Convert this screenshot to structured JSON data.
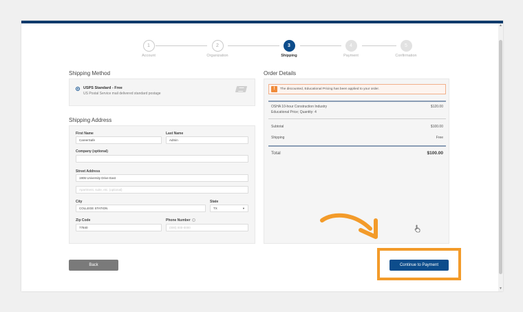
{
  "stepper": {
    "steps": [
      {
        "number": "1",
        "label": "Account"
      },
      {
        "number": "2",
        "label": "Organization"
      },
      {
        "number": "3",
        "label": "Shipping"
      },
      {
        "number": "4",
        "label": "Payment"
      },
      {
        "number": "5",
        "label": "Confirmation"
      }
    ],
    "active_step": 3
  },
  "shipping_method": {
    "title": "Shipping Method",
    "option_name": "USPS Standard - Free",
    "option_desc": "US Postal Service mail delivered standard postage",
    "icon": "usps-eagle-icon"
  },
  "shipping_address": {
    "title": "Shipping Address",
    "first_name_label": "First Name",
    "first_name_value": "CareerSafe",
    "last_name_label": "Last Name",
    "last_name_value": "Admin",
    "company_label": "Company (optional)",
    "company_value": "",
    "street_label": "Street Address",
    "street_value": "1906 University Drive East",
    "street2_placeholder": "Apartment, suite, etc. (optional)",
    "city_label": "City",
    "city_value": "COLLEGE STATION",
    "state_label": "State",
    "state_value": "TX",
    "zip_label": "Zip Code",
    "zip_value": "77840",
    "phone_label": "Phone Number",
    "phone_placeholder": "(000) 000-0000"
  },
  "order_details": {
    "title": "Order Details",
    "notice": "The discounted, Educational Pricing has been applied to your order.",
    "notice_icon_glyph": "!",
    "item_name": "OSHA 10-hour Construction Industry",
    "item_detail": "Educational Price; Quantity: 4",
    "item_price": "$120.00",
    "subtotal_label": "Subtotal",
    "subtotal_value": "$100.00",
    "shipping_label": "Shipping",
    "shipping_value": "Free",
    "total_label": "Total",
    "total_value": "$100.00"
  },
  "buttons": {
    "back": "Back",
    "continue": "Continue to Payment"
  },
  "colors": {
    "primary": "#0d4d8c",
    "highlight": "#f39b2a",
    "notice_border": "#f2b08a"
  }
}
